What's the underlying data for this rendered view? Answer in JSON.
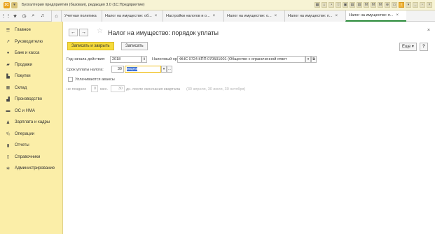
{
  "app": {
    "title": "Бухгалтерия предприятия (базовая), редакция 3.0  (1С:Предприятие)",
    "logo_icon": "1c-logo-icon",
    "brand_color": "#f6db3b"
  },
  "tabs": [
    {
      "label": "Учетная политика"
    },
    {
      "label": "Налог на имуществе: об..."
    },
    {
      "label": "Настройки налогов и о..."
    },
    {
      "label": "Налог на имуществе: о..."
    },
    {
      "label": "Налог на имуществе: п..."
    },
    {
      "label": "Налог на имуществе: п..."
    }
  ],
  "sidebar": {
    "items": [
      {
        "label": "Главное",
        "icon": "menu-icon"
      },
      {
        "label": "Руководителю",
        "icon": "trend-icon"
      },
      {
        "label": "Банк и касса",
        "icon": "coin-icon"
      },
      {
        "label": "Продажи",
        "icon": "bag-icon"
      },
      {
        "label": "Покупки",
        "icon": "cart-icon"
      },
      {
        "label": "Склад",
        "icon": "warehouse-icon"
      },
      {
        "label": "Производство",
        "icon": "factory-icon"
      },
      {
        "label": "ОС и НМА",
        "icon": "truck-icon"
      },
      {
        "label": "Зарплата и кадры",
        "icon": "person-icon"
      },
      {
        "label": "Операции",
        "icon": "operations-icon"
      },
      {
        "label": "Отчеты",
        "icon": "report-icon"
      },
      {
        "label": "Справочники",
        "icon": "book-icon"
      },
      {
        "label": "Администрирование",
        "icon": "gear-icon"
      }
    ]
  },
  "form": {
    "title": "Налог на имущество: порядок уплаты",
    "save_close_label": "Записать и закрыть",
    "save_label": "Записать",
    "more_label": "Еще",
    "help_label": "?",
    "year_label": "Год начала действия:",
    "year_value": "2018",
    "tax_authority_label": "Налоговый орган:",
    "tax_authority_value": "ФНС 0724 КПП 070501001 (Общество с ограниченной ответ",
    "deadline_label": "Срок уплаты налога:",
    "deadline_day": "30",
    "deadline_month": "марта",
    "advances_label": "Уплачиваются авансы",
    "advance_prefix": "не позднее",
    "advance_months": "0",
    "advance_months_unit": "мес.",
    "advance_days": "30",
    "advance_suffix": "дн. после окончания квартала",
    "advance_hint": "(30 апреля, 30 июля, 30 октября)"
  }
}
